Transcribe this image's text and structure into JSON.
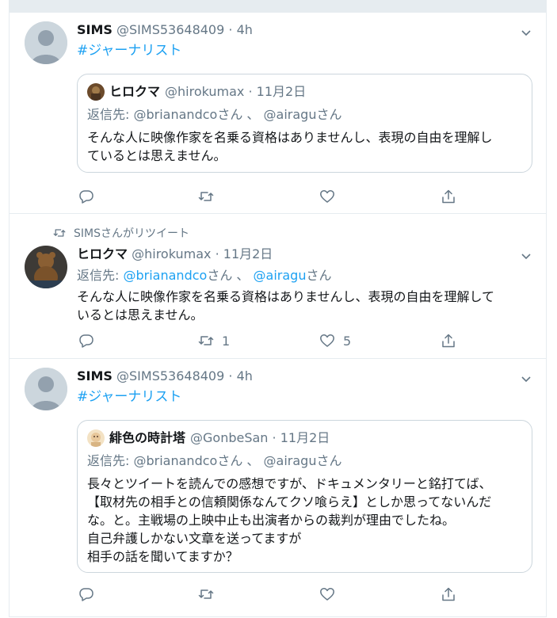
{
  "tweets": [
    {
      "name": "SIMS",
      "handle": "@SIMS53648409",
      "time": "4h",
      "hashtag": "#ジャーナリスト",
      "quote": {
        "name": "ヒロクマ",
        "handle": "@hirokumax",
        "time": "11月2日",
        "reply_prefix": "返信先:",
        "reply_1": "@brianandcoさん",
        "reply_sep": "、",
        "reply_2": "@airaguさん",
        "lines": [
          "そんな人に映像作家を名乗る資格はありませんし、表現の自由を理解し",
          "ているとは思えません。"
        ]
      }
    },
    {
      "retweet_label": "SIMSさんがリツイート",
      "name": "ヒロクマ",
      "handle": "@hirokumax",
      "time": "11月2日",
      "reply_prefix": "返信先:",
      "reply_1": "@brianandco",
      "reply_1_suffix": "さん",
      "reply_sep": "、",
      "reply_2": "@airagu",
      "reply_2_suffix": "さん",
      "lines": [
        "そんな人に映像作家を名乗る資格はありませんし、表現の自由を理解して",
        "いるとは思えません。"
      ],
      "retweet_count": "1",
      "like_count": "5"
    },
    {
      "name": "SIMS",
      "handle": "@SIMS53648409",
      "time": "4h",
      "hashtag": "#ジャーナリスト",
      "quote": {
        "name": "緋色の時計塔",
        "handle": "@GonbeSan",
        "time": "11月2日",
        "reply_prefix": "返信先:",
        "reply_1": "@brianandcoさん",
        "reply_sep": "、",
        "reply_2": "@airaguさん",
        "lines": [
          "長々とツイートを読んでの感想ですが、ドキュメンタリーと銘打てば、",
          "【取材先の相手との信頼関係なんてクソ喰らえ】としか思ってないんだ",
          "な。と。主戦場の上映中止も出演者からの裁判が理由でしたね。",
          "自己弁護しかない文章を送ってますが",
          "相手の話を聞いてますか？"
        ]
      }
    }
  ],
  "icons": [
    "caret-down-icon",
    "reply-icon",
    "retweet-icon",
    "like-icon",
    "share-icon"
  ],
  "colors": {
    "link": "#1da1f2",
    "muted": "#657786",
    "border": "#e6ecf0",
    "text": "#14171a"
  }
}
